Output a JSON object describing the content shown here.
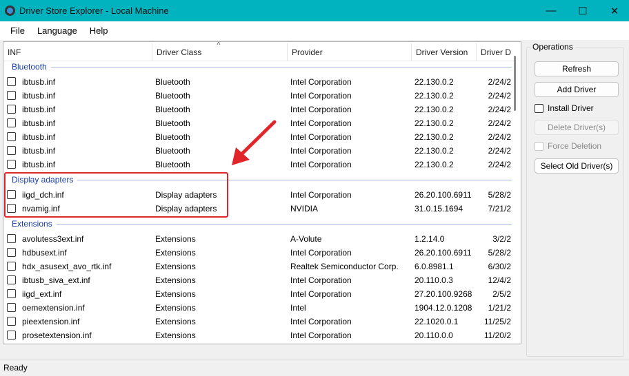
{
  "window": {
    "title": "Driver Store Explorer - Local Machine",
    "minimize": "—",
    "maximize": "☐",
    "close": "✕"
  },
  "menu": [
    "File",
    "Language",
    "Help"
  ],
  "columns": [
    "INF",
    "Driver Class",
    "Provider",
    "Driver Version",
    "Driver D"
  ],
  "groups": [
    {
      "name": "Bluetooth",
      "rows": [
        [
          "ibtusb.inf",
          "Bluetooth",
          "Intel Corporation",
          "22.130.0.2",
          "2/24/2"
        ],
        [
          "ibtusb.inf",
          "Bluetooth",
          "Intel Corporation",
          "22.130.0.2",
          "2/24/2"
        ],
        [
          "ibtusb.inf",
          "Bluetooth",
          "Intel Corporation",
          "22.130.0.2",
          "2/24/2"
        ],
        [
          "ibtusb.inf",
          "Bluetooth",
          "Intel Corporation",
          "22.130.0.2",
          "2/24/2"
        ],
        [
          "ibtusb.inf",
          "Bluetooth",
          "Intel Corporation",
          "22.130.0.2",
          "2/24/2"
        ],
        [
          "ibtusb.inf",
          "Bluetooth",
          "Intel Corporation",
          "22.130.0.2",
          "2/24/2"
        ],
        [
          "ibtusb.inf",
          "Bluetooth",
          "Intel Corporation",
          "22.130.0.2",
          "2/24/2"
        ]
      ]
    },
    {
      "name": "Display adapters",
      "rows": [
        [
          "iigd_dch.inf",
          "Display adapters",
          "Intel Corporation",
          "26.20.100.6911",
          "5/28/2"
        ],
        [
          "nvamig.inf",
          "Display adapters",
          "NVIDIA",
          "31.0.15.1694",
          "7/21/2"
        ]
      ]
    },
    {
      "name": "Extensions",
      "rows": [
        [
          "avolutess3ext.inf",
          "Extensions",
          "A-Volute",
          "1.2.14.0",
          "3/2/2"
        ],
        [
          "hdbusext.inf",
          "Extensions",
          "Intel Corporation",
          "26.20.100.6911",
          "5/28/2"
        ],
        [
          "hdx_asusext_avo_rtk.inf",
          "Extensions",
          "Realtek Semiconductor Corp.",
          "6.0.8981.1",
          "6/30/2"
        ],
        [
          "ibtusb_siva_ext.inf",
          "Extensions",
          "Intel Corporation",
          "20.110.0.3",
          "12/4/2"
        ],
        [
          "iigd_ext.inf",
          "Extensions",
          "Intel Corporation",
          "27.20.100.9268",
          "2/5/2"
        ],
        [
          "oemextension.inf",
          "Extensions",
          "Intel",
          "1904.12.0.1208",
          "1/21/2"
        ],
        [
          "pieextension.inf",
          "Extensions",
          "Intel Corporation",
          "22.1020.0.1",
          "11/25/2"
        ],
        [
          "prosetextension.inf",
          "Extensions",
          "Intel Corporation",
          "20.110.0.0",
          "11/20/2"
        ]
      ]
    }
  ],
  "operations": {
    "label": "Operations",
    "refresh": "Refresh",
    "add_driver": "Add Driver",
    "install_driver": "Install Driver",
    "delete_driver": "Delete Driver(s)",
    "force_deletion": "Force Deletion",
    "select_old": "Select Old Driver(s)"
  },
  "status": "Ready",
  "colors": {
    "titlebar": "#00b3be",
    "group": "#1a3ca6",
    "highlight": "#e0262a"
  }
}
